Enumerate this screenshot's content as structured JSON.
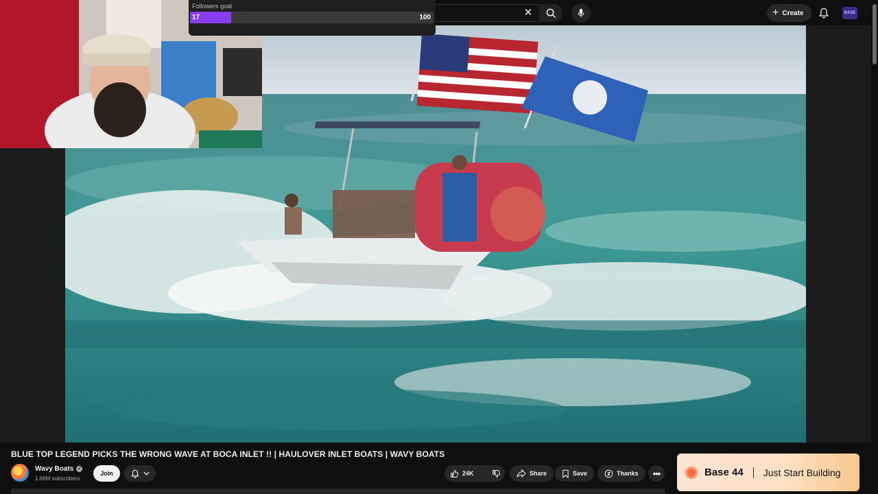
{
  "header": {
    "search_clear": "✕",
    "create_label": "Create",
    "account_badge": "BASE"
  },
  "overlay": {
    "followers_label": "Followers goal",
    "current": "17",
    "target": "100",
    "progress_fraction": 0.17,
    "fill_color": "#8a3cf0"
  },
  "video": {
    "title": "BLUE TOP LEGEND PICKS THE WRONG WAVE AT BOCA INLET !! | HAULOVER INLET BOATS | WAVY BOATS"
  },
  "channel": {
    "name": "Wavy Boats",
    "subscribers": "1.66M subscribers",
    "join_label": "Join"
  },
  "actions": {
    "likes": "24K",
    "share": "Share",
    "save": "Save",
    "thanks": "Thanks"
  },
  "ad": {
    "brand": "Base 44",
    "tagline": "Just Start Building"
  },
  "icons": {
    "search": "search-icon",
    "mic": "mic-icon",
    "bell": "bell-icon",
    "like": "thumbs-up-icon",
    "dislike": "thumbs-down-icon"
  }
}
